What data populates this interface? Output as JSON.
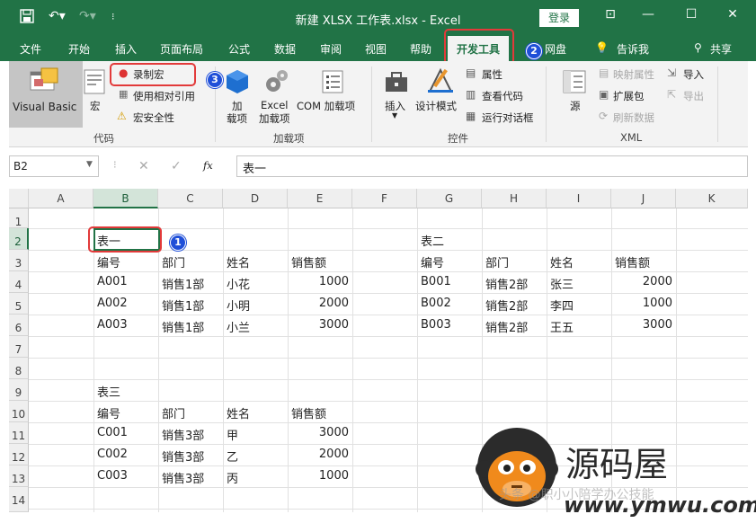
{
  "titlebar": {
    "title": "新建 XLSX 工作表.xlsx  -  Excel",
    "signin": "登录",
    "minimize_glyph": "—",
    "maximize_glyph": "☐",
    "close_glyph": "✕",
    "ribbon_opts_glyph": "⊡"
  },
  "tabs": {
    "file": "文件",
    "home": "开始",
    "insert": "插入",
    "layout": "页面布局",
    "formulas": "公式",
    "data": "数据",
    "review": "审阅",
    "view": "视图",
    "help": "帮助",
    "developer": "开发工具",
    "netdisk": "网盘",
    "tellme": "告诉我",
    "share": "共享"
  },
  "badges": {
    "b1": "1",
    "b2": "2",
    "b3": "3"
  },
  "ribbon": {
    "code": {
      "visual_basic": "Visual Basic",
      "macros": "宏",
      "record_macro": "录制宏",
      "relative_ref": "使用相对引用",
      "macro_security": "宏安全性",
      "group": "代码"
    },
    "addins": {
      "addins_l1": "加",
      "addins_l2": "载项",
      "excel_l1": "Excel",
      "excel_l2": "加载项",
      "com": "COM 加载项",
      "group": "加载项"
    },
    "controls": {
      "insert": "插入",
      "design_mode": "设计模式",
      "properties": "属性",
      "view_code": "查看代码",
      "run_dialog": "运行对话框",
      "group": "控件"
    },
    "xml": {
      "source": "源",
      "map_props": "映射属性",
      "expansion": "扩展包",
      "refresh": "刷新数据",
      "import": "导入",
      "export": "导出",
      "group": "XML"
    }
  },
  "formula_bar": {
    "name_box": "B2",
    "cancel": "✕",
    "enter": "✓",
    "fx": "fx",
    "content": "表一"
  },
  "columns": [
    "A",
    "B",
    "C",
    "D",
    "E",
    "F",
    "G",
    "H",
    "I",
    "J",
    "K"
  ],
  "rows": [
    "1",
    "2",
    "3",
    "4",
    "5",
    "6",
    "7",
    "8",
    "9",
    "10",
    "11",
    "12",
    "13",
    "14"
  ],
  "table1": {
    "title": "表一",
    "headers": [
      "编号",
      "部门",
      "姓名",
      "销售额"
    ],
    "rows": [
      [
        "A001",
        "销售1部",
        "小花",
        "1000"
      ],
      [
        "A002",
        "销售1部",
        "小明",
        "2000"
      ],
      [
        "A003",
        "销售1部",
        "小兰",
        "3000"
      ]
    ]
  },
  "table2": {
    "title": "表二",
    "headers": [
      "编号",
      "部门",
      "姓名",
      "销售额"
    ],
    "rows": [
      [
        "B001",
        "销售2部",
        "张三",
        "2000"
      ],
      [
        "B002",
        "销售2部",
        "李四",
        "1000"
      ],
      [
        "B003",
        "销售2部",
        "王五",
        "3000"
      ]
    ]
  },
  "table3": {
    "title": "表三",
    "headers": [
      "编号",
      "部门",
      "姓名",
      "销售额"
    ],
    "rows": [
      [
        "C001",
        "销售3部",
        "甲",
        "3000"
      ],
      [
        "C002",
        "销售3部",
        "乙",
        "2000"
      ],
      [
        "C003",
        "销售3部",
        "丙",
        "1000"
      ]
    ]
  },
  "watermark": {
    "brand": "源码屋",
    "url": "www.ymwu.com",
    "faint": "头条 @职小小陪学办公技能"
  },
  "colors": {
    "excel_green": "#217346",
    "highlight_red": "#e23a3a",
    "badge_blue": "#1f4fd8",
    "watermark_orange": "#f08a1c"
  }
}
